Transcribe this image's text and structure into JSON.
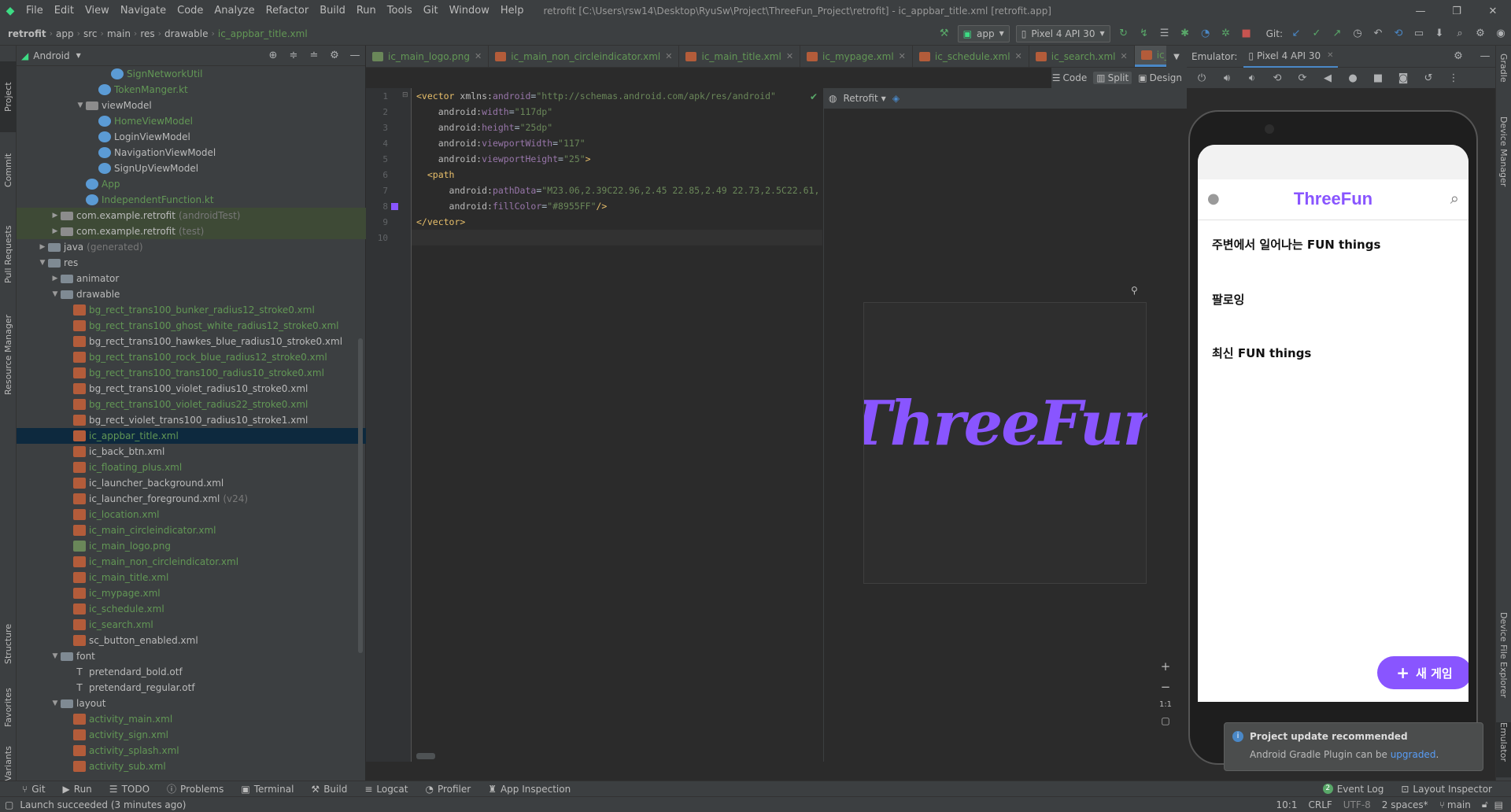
{
  "menubar": {
    "items": [
      "File",
      "Edit",
      "View",
      "Navigate",
      "Code",
      "Analyze",
      "Refactor",
      "Build",
      "Run",
      "Tools",
      "Git",
      "Window",
      "Help"
    ],
    "title": "retrofit [C:\\Users\\rsw14\\Desktop\\RyuSw\\Project\\ThreeFun_Project\\retrofit] - ic_appbar_title.xml [retrofit.app]"
  },
  "breadcrumb": [
    "retrofit",
    "app",
    "src",
    "main",
    "res",
    "drawable",
    "ic_appbar_title.xml"
  ],
  "toolbar": {
    "run_config": "app",
    "device": "Pixel 4 API 30",
    "git_label": "Git:"
  },
  "project_panel": {
    "view_mode": "Android",
    "rows": [
      {
        "label": "SignNetworkUtil",
        "indent": 6,
        "icon": "kt",
        "color": "green",
        "arrow": ""
      },
      {
        "label": "TokenManger.kt",
        "indent": 5,
        "icon": "kt",
        "color": "green",
        "arrow": ""
      },
      {
        "label": "viewModel",
        "indent": 4,
        "icon": "pkg",
        "color": "gray",
        "arrow": "down"
      },
      {
        "label": "HomeViewModel",
        "indent": 5,
        "icon": "kt",
        "color": "green",
        "arrow": ""
      },
      {
        "label": "LoginViewModel",
        "indent": 5,
        "icon": "kt",
        "color": "gray",
        "arrow": ""
      },
      {
        "label": "NavigationViewModel",
        "indent": 5,
        "icon": "kt",
        "color": "gray",
        "arrow": ""
      },
      {
        "label": "SignUpViewModel",
        "indent": 5,
        "icon": "kt",
        "color": "gray",
        "arrow": ""
      },
      {
        "label": "App",
        "indent": 4,
        "icon": "kt",
        "color": "green",
        "arrow": ""
      },
      {
        "label": "IndependentFunction.kt",
        "indent": 4,
        "icon": "kt",
        "color": "green",
        "arrow": ""
      },
      {
        "label": "com.example.retrofit",
        "suffix": "(androidTest)",
        "indent": 2,
        "icon": "pkg",
        "color": "gray",
        "arrow": "right",
        "mod": true
      },
      {
        "label": "com.example.retrofit",
        "suffix": "(test)",
        "indent": 2,
        "icon": "pkg",
        "color": "gray",
        "arrow": "right",
        "mod": true
      },
      {
        "label": "java",
        "suffix": "(generated)",
        "indent": 1,
        "icon": "folder",
        "color": "gray",
        "arrow": "right"
      },
      {
        "label": "res",
        "indent": 1,
        "icon": "folder",
        "color": "gray",
        "arrow": "down"
      },
      {
        "label": "animator",
        "indent": 2,
        "icon": "folder",
        "color": "gray",
        "arrow": "right"
      },
      {
        "label": "drawable",
        "indent": 2,
        "icon": "folder",
        "color": "gray",
        "arrow": "down"
      },
      {
        "label": "bg_rect_trans100_bunker_radius12_stroke0.xml",
        "indent": 3,
        "icon": "xml",
        "color": "green",
        "arrow": ""
      },
      {
        "label": "bg_rect_trans100_ghost_white_radius12_stroke0.xml",
        "indent": 3,
        "icon": "xml",
        "color": "green",
        "arrow": ""
      },
      {
        "label": "bg_rect_trans100_hawkes_blue_radius10_stroke0.xml",
        "indent": 3,
        "icon": "xml",
        "color": "gray",
        "arrow": ""
      },
      {
        "label": "bg_rect_trans100_rock_blue_radius12_stroke0.xml",
        "indent": 3,
        "icon": "xml",
        "color": "green",
        "arrow": ""
      },
      {
        "label": "bg_rect_trans100_trans100_radius10_stroke0.xml",
        "indent": 3,
        "icon": "xml",
        "color": "green",
        "arrow": ""
      },
      {
        "label": "bg_rect_trans100_violet_radius10_stroke0.xml",
        "indent": 3,
        "icon": "xml",
        "color": "gray",
        "arrow": ""
      },
      {
        "label": "bg_rect_trans100_violet_radius22_stroke0.xml",
        "indent": 3,
        "icon": "xml",
        "color": "green",
        "arrow": ""
      },
      {
        "label": "bg_rect_violet_trans100_radius10_stroke1.xml",
        "indent": 3,
        "icon": "xml",
        "color": "gray",
        "arrow": ""
      },
      {
        "label": "ic_appbar_title.xml",
        "indent": 3,
        "icon": "xml",
        "color": "green",
        "arrow": "",
        "selected": true
      },
      {
        "label": "ic_back_btn.xml",
        "indent": 3,
        "icon": "xml",
        "color": "gray",
        "arrow": ""
      },
      {
        "label": "ic_floating_plus.xml",
        "indent": 3,
        "icon": "xml",
        "color": "green",
        "arrow": ""
      },
      {
        "label": "ic_launcher_background.xml",
        "indent": 3,
        "icon": "xml",
        "color": "gray",
        "arrow": ""
      },
      {
        "label": "ic_launcher_foreground.xml",
        "suffix": "(v24)",
        "indent": 3,
        "icon": "xml",
        "color": "gray",
        "arrow": ""
      },
      {
        "label": "ic_location.xml",
        "indent": 3,
        "icon": "xml",
        "color": "green",
        "arrow": ""
      },
      {
        "label": "ic_main_circleindicator.xml",
        "indent": 3,
        "icon": "xml",
        "color": "green",
        "arrow": ""
      },
      {
        "label": "ic_main_logo.png",
        "indent": 3,
        "icon": "png",
        "color": "green",
        "arrow": ""
      },
      {
        "label": "ic_main_non_circleindicator.xml",
        "indent": 3,
        "icon": "xml",
        "color": "green",
        "arrow": ""
      },
      {
        "label": "ic_main_title.xml",
        "indent": 3,
        "icon": "xml",
        "color": "green",
        "arrow": ""
      },
      {
        "label": "ic_mypage.xml",
        "indent": 3,
        "icon": "xml",
        "color": "green",
        "arrow": ""
      },
      {
        "label": "ic_schedule.xml",
        "indent": 3,
        "icon": "xml",
        "color": "green",
        "arrow": ""
      },
      {
        "label": "ic_search.xml",
        "indent": 3,
        "icon": "xml",
        "color": "green",
        "arrow": ""
      },
      {
        "label": "sc_button_enabled.xml",
        "indent": 3,
        "icon": "xml",
        "color": "gray",
        "arrow": ""
      },
      {
        "label": "font",
        "indent": 2,
        "icon": "folder",
        "color": "gray",
        "arrow": "down"
      },
      {
        "label": "pretendard_bold.otf",
        "indent": 3,
        "icon": "font",
        "color": "gray",
        "arrow": ""
      },
      {
        "label": "pretendard_regular.otf",
        "indent": 3,
        "icon": "font",
        "color": "gray",
        "arrow": ""
      },
      {
        "label": "layout",
        "indent": 2,
        "icon": "folder",
        "color": "gray",
        "arrow": "down"
      },
      {
        "label": "activity_main.xml",
        "indent": 3,
        "icon": "xml",
        "color": "green",
        "arrow": ""
      },
      {
        "label": "activity_sign.xml",
        "indent": 3,
        "icon": "xml",
        "color": "green",
        "arrow": ""
      },
      {
        "label": "activity_splash.xml",
        "indent": 3,
        "icon": "xml",
        "color": "green",
        "arrow": ""
      },
      {
        "label": "activity_sub.xml",
        "indent": 3,
        "icon": "xml",
        "color": "green",
        "arrow": ""
      }
    ]
  },
  "left_stripe": [
    "Project",
    "Commit",
    "Pull Requests",
    "Resource Manager",
    "Structure",
    "Favorites",
    "Build Variants"
  ],
  "right_stripe": [
    "Gradle",
    "Device Manager",
    "Device File Explorer",
    "Emulator"
  ],
  "editor_tabs": [
    {
      "label": "ic_main_logo.png",
      "icon": "png",
      "active": false
    },
    {
      "label": "ic_main_non_circleindicator.xml",
      "icon": "xml",
      "active": false
    },
    {
      "label": "ic_main_title.xml",
      "icon": "xml",
      "active": false
    },
    {
      "label": "ic_mypage.xml",
      "icon": "xml",
      "active": false
    },
    {
      "label": "ic_schedule.xml",
      "icon": "xml",
      "active": false
    },
    {
      "label": "ic_search.xml",
      "icon": "xml",
      "active": false
    },
    {
      "label": "ic_appbar_title.xml",
      "icon": "xml",
      "active": true
    }
  ],
  "mode_bar": {
    "code": "Code",
    "split": "Split",
    "design": "Design"
  },
  "code_lines": [
    [
      [
        "t-tag",
        "<vector "
      ],
      [
        "t-ns",
        "xmlns:"
      ],
      [
        "t-attr",
        "android"
      ],
      [
        "t-plain",
        "="
      ],
      [
        "t-str",
        "\"http://schemas.android.com/apk/res/android\""
      ]
    ],
    [
      [
        "t-plain",
        "    "
      ],
      [
        "t-ns",
        "android:"
      ],
      [
        "t-attr",
        "width"
      ],
      [
        "t-plain",
        "="
      ],
      [
        "t-str",
        "\"117dp\""
      ]
    ],
    [
      [
        "t-plain",
        "    "
      ],
      [
        "t-ns",
        "android:"
      ],
      [
        "t-attr",
        "height"
      ],
      [
        "t-plain",
        "="
      ],
      [
        "t-str",
        "\"25dp\""
      ]
    ],
    [
      [
        "t-plain",
        "    "
      ],
      [
        "t-ns",
        "android:"
      ],
      [
        "t-attr",
        "viewportWidth"
      ],
      [
        "t-plain",
        "="
      ],
      [
        "t-str",
        "\"117\""
      ]
    ],
    [
      [
        "t-plain",
        "    "
      ],
      [
        "t-ns",
        "android:"
      ],
      [
        "t-attr",
        "viewportHeight"
      ],
      [
        "t-plain",
        "="
      ],
      [
        "t-str",
        "\"25\""
      ],
      [
        "t-tag",
        ">"
      ]
    ],
    [
      [
        "t-plain",
        "  "
      ],
      [
        "t-tag",
        "<path"
      ]
    ],
    [
      [
        "t-plain",
        "      "
      ],
      [
        "t-ns",
        "android:"
      ],
      [
        "t-attr",
        "pathData"
      ],
      [
        "t-plain",
        "="
      ],
      [
        "t-str",
        "\"M23.06,2.39C22.96,2.45 22.85,2.49 22.73,2.5C22.61,"
      ]
    ],
    [
      [
        "t-plain",
        "      "
      ],
      [
        "t-ns",
        "android:"
      ],
      [
        "t-attr",
        "fillColor"
      ],
      [
        "t-plain",
        "="
      ],
      [
        "t-str",
        "\"#8955FF\""
      ],
      [
        "t-tag",
        "/>"
      ]
    ],
    [
      [
        "t-tag",
        "</vector>"
      ]
    ],
    [
      [
        "t-plain",
        ""
      ]
    ]
  ],
  "line_numbers": [
    "1",
    "2",
    "3",
    "4",
    "5",
    "6",
    "7",
    "8",
    "9",
    "10"
  ],
  "design": {
    "theme_label": "Retrofit",
    "preview_text": "ThreeFun",
    "preview_color": "#8955FF",
    "zoom_label": "1:1"
  },
  "emulator": {
    "label": "Emulator:",
    "device_tab": "Pixel 4 API 30"
  },
  "app": {
    "title": "ThreeFun",
    "brand_color": "#8955FF",
    "section_nearby": "주변에서 일어나는 FUN things",
    "section_following": "팔로잉",
    "section_recent": "최신 FUN things",
    "fab_label": "새 게임"
  },
  "notification": {
    "title": "Project update recommended",
    "body_prefix": "Android Gradle Plugin can be ",
    "body_link": "upgraded",
    "body_suffix": "."
  },
  "bottom_tools": [
    "Git",
    "Run",
    "TODO",
    "Problems",
    "Terminal",
    "Build",
    "Logcat",
    "Profiler",
    "App Inspection"
  ],
  "bottom_tools_right": [
    "Event Log",
    "Layout Inspector"
  ],
  "event_log_count": "2",
  "status": {
    "message": "Launch succeeded (3 minutes ago)",
    "position": "10:1",
    "line_sep": "CRLF",
    "encoding": "UTF-8",
    "indent": "2 spaces*",
    "branch": "main"
  }
}
